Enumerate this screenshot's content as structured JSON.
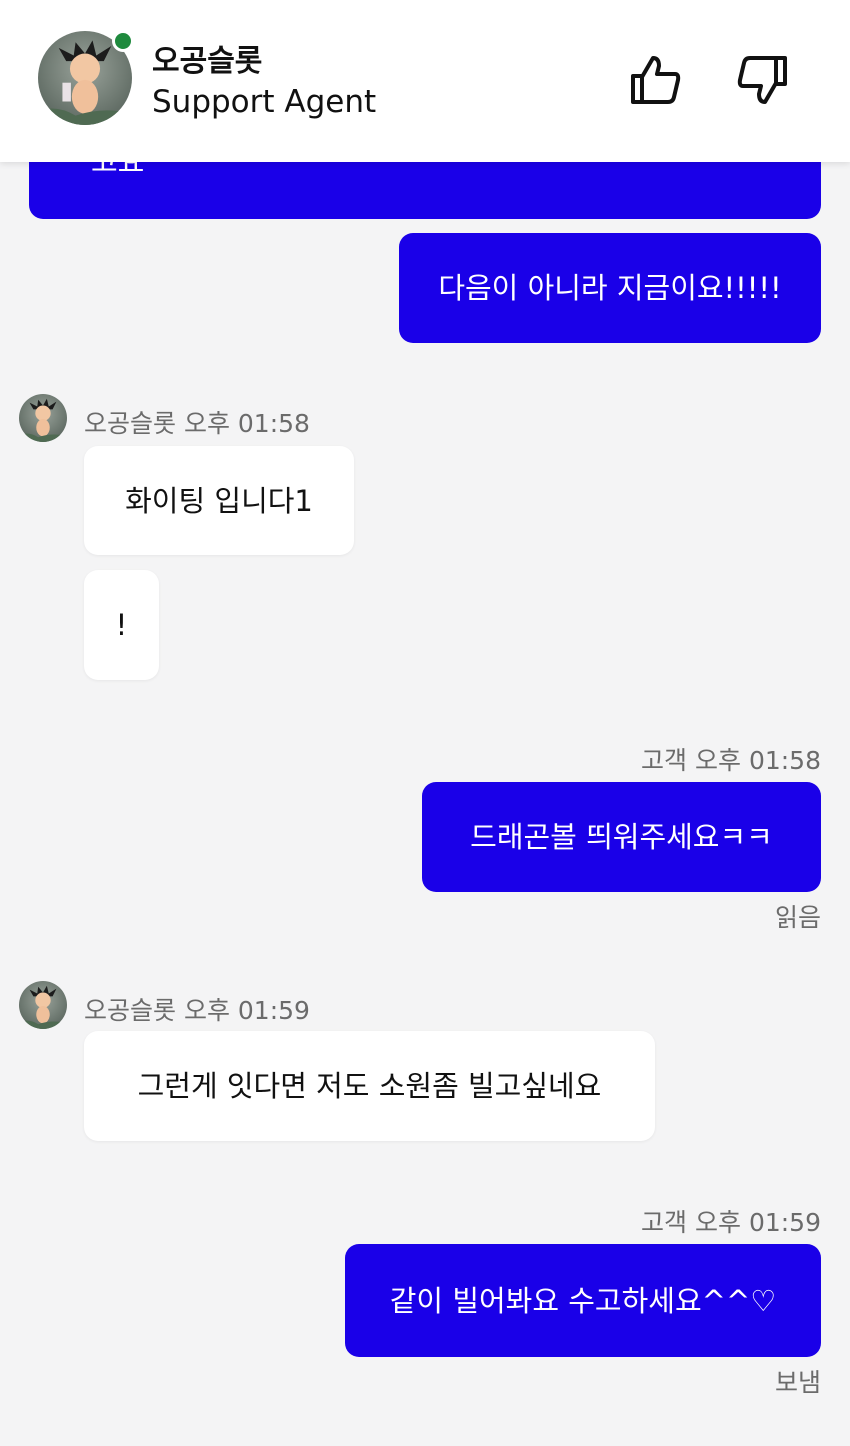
{
  "header": {
    "agent_name": "오공슬롯",
    "agent_role": "Support Agent",
    "status_color": "#1f8a3e"
  },
  "messages": [
    {
      "sender": "customer",
      "text": "고요"
    },
    {
      "sender": "customer",
      "text": "다음이 아니라 지금이요!!!!!"
    },
    {
      "sender": "agent",
      "author": "오공슬롯 오후 01:58",
      "text": "화이팅 입니다1"
    },
    {
      "sender": "agent",
      "text": "!"
    },
    {
      "sender": "customer",
      "author": "고객 오후 01:58",
      "text": "드래곤볼 띄워주세요ㅋㅋ",
      "status": "읽음"
    },
    {
      "sender": "agent",
      "author": "오공슬롯 오후 01:59",
      "text": "그런게 잇다면 저도 소원좀 빌고싶네요"
    },
    {
      "sender": "customer",
      "author": "고객 오후 01:59",
      "text": "같이 빌어봐요 수고하세요^^♡",
      "status": "보냄"
    }
  ],
  "colors": {
    "customer_bubble": "#1a00e8",
    "agent_bubble": "#ffffff",
    "background": "#f4f4f5"
  },
  "icons": {
    "like": "thumbs-up-icon",
    "dislike": "thumbs-down-icon"
  }
}
